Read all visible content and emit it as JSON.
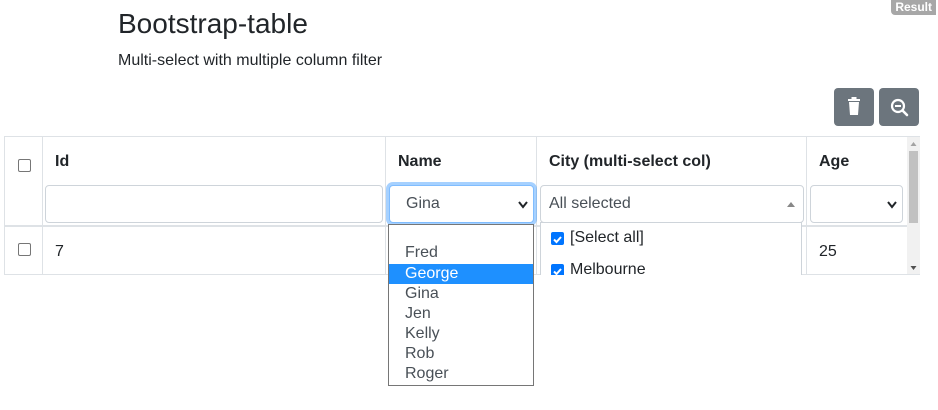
{
  "badge": "Result",
  "header": {
    "title": "Bootstrap-table",
    "subtitle": "Multi-select with multiple column filter"
  },
  "toolbar": {
    "delete_icon": "trash-icon",
    "search_icon": "zoom-out-icon",
    "button_color": "#6c757d"
  },
  "table": {
    "columns": [
      {
        "key": "id",
        "label": "Id"
      },
      {
        "key": "name",
        "label": "Name"
      },
      {
        "key": "city",
        "label": "City (multi-select col)"
      },
      {
        "key": "age",
        "label": "Age"
      }
    ],
    "filters": {
      "id": "",
      "name": "Gina",
      "city": "All selected",
      "age": ""
    },
    "rows": [
      {
        "id": "7",
        "age": "25"
      }
    ]
  },
  "name_dropdown": {
    "options": [
      "",
      "Fred",
      "George",
      "Gina",
      "Jen",
      "Kelly",
      "Rob",
      "Roger"
    ],
    "highlighted": "George",
    "highlight_color": "#1e90ff"
  },
  "city_dropdown": {
    "options": [
      {
        "label": "[Select all]",
        "checked": true
      },
      {
        "label": "Melbourne",
        "checked": true
      }
    ],
    "check_color": "#0075ff"
  }
}
